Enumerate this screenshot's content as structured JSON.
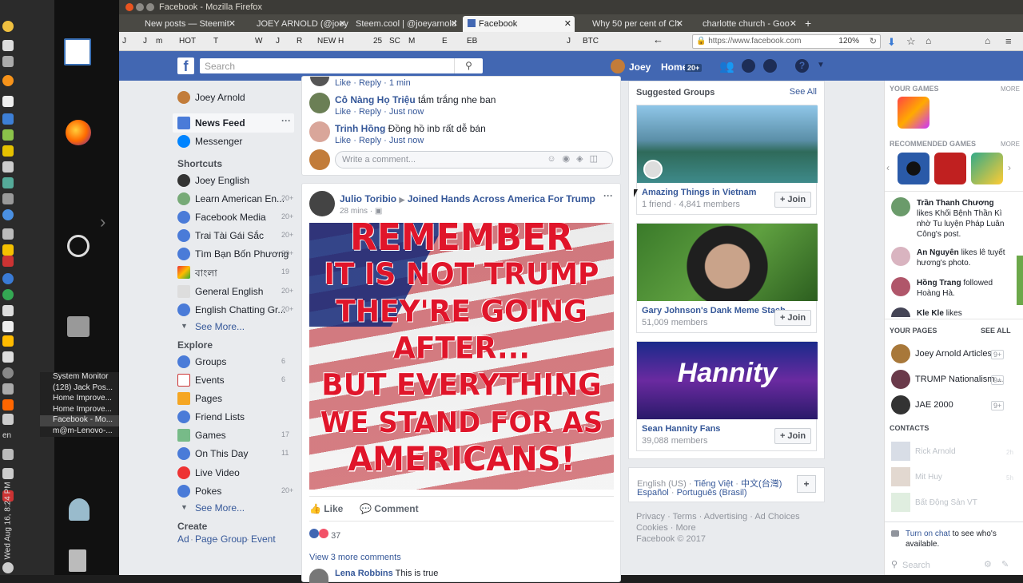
{
  "window": {
    "title": "Facebook - Mozilla Firefox"
  },
  "tabs": [
    {
      "label": "New posts — Steemit"
    },
    {
      "label": "JOEY ARNOLD (@joey"
    },
    {
      "label": "Steem.cool | @joeyarnold"
    },
    {
      "label": "Facebook"
    },
    {
      "label": "Why 50 per cent of Ch"
    },
    {
      "label": "charlotte church - Goo"
    }
  ],
  "bookmarks": [
    "J",
    "J",
    "m",
    "HOT",
    "T",
    "W",
    "J",
    "R",
    "NEW",
    "H",
    "25",
    "SC",
    "M",
    "E",
    "EB",
    "J",
    "BTC"
  ],
  "url": {
    "value": "https://www.facebook.com",
    "zoom": "120%"
  },
  "winlist": [
    "System Monitor",
    "(128) Jack Pos...",
    "Home Improve...",
    "Home Improve...",
    "Facebook - Mo...",
    "m@m-Lenovo-..."
  ],
  "clock": "Wed Aug 16, 8:24 PM",
  "lang": "en",
  "fb": {
    "search_placeholder": "Search",
    "user": "Joey",
    "home": "Home",
    "home_count": "20+"
  },
  "leftnav": {
    "profile": "Joey Arnold",
    "news_feed": "News Feed",
    "messenger": "Messenger",
    "shortcuts_title": "Shortcuts",
    "shortcuts": [
      {
        "label": "Joey English",
        "count": ""
      },
      {
        "label": "Learn American En...",
        "count": "20+"
      },
      {
        "label": "Facebook Media",
        "count": "20+"
      },
      {
        "label": "Trai Tài Gái Sắc",
        "count": "20+"
      },
      {
        "label": "Tìm Bạn Bốn Phương",
        "count": "20+"
      },
      {
        "label": "বাংলা",
        "count": "19"
      },
      {
        "label": "General English",
        "count": "20+"
      },
      {
        "label": "English Chatting Gr...",
        "count": "20+"
      }
    ],
    "see_more": "See More...",
    "explore_title": "Explore",
    "explore": [
      {
        "label": "Groups",
        "count": "6"
      },
      {
        "label": "Events",
        "count": "6"
      },
      {
        "label": "Pages",
        "count": ""
      },
      {
        "label": "Friend Lists",
        "count": ""
      },
      {
        "label": "Games",
        "count": "17"
      },
      {
        "label": "On This Day",
        "count": "11"
      },
      {
        "label": "Live Video",
        "count": ""
      },
      {
        "label": "Pokes",
        "count": "20+"
      }
    ],
    "see_more2": "See More...",
    "create_title": "Create",
    "create": [
      "Ad",
      "Page",
      "Group",
      "Event"
    ]
  },
  "comments": [
    {
      "actions": "Like · Reply · 1 min"
    },
    {
      "name": "Cô Nàng Họ Triệu",
      "text": "tắm trắng nhe ban",
      "actions": "Like · Reply · Just now"
    },
    {
      "name": "Trinh Hồng",
      "text": "Đồng hồ inb rất dễ bán",
      "actions": "Like · Reply · Just now"
    }
  ],
  "comment_placeholder": "Write a comment...",
  "post": {
    "author": "Julio Toribio",
    "group": "Joined Hands Across America For Trump",
    "time": "28 mins",
    "image_text": [
      "REMEMBER",
      "IT IS NOT TRUMP",
      "THEY'RE GOING",
      "AFTER...",
      "BUT EVERYTHING",
      "WE STAND FOR AS",
      "AMERICANS!"
    ],
    "like": "Like",
    "comment": "Comment",
    "reactions": "37",
    "view_more": "View 3 more comments",
    "next_commenter": "Lena Robbins",
    "next_comment": "This is true"
  },
  "suggested": {
    "title": "Suggested Groups",
    "see_all": "See All",
    "groups": [
      {
        "name": "Amazing Things in Vietnam",
        "members": "1 friend · 4,841 members"
      },
      {
        "name": "Gary Johnson's Dank Meme Stash",
        "members": "51,009 members"
      },
      {
        "name": "Sean Hannity Fans",
        "members": "39,088 members"
      }
    ],
    "join": "Join"
  },
  "footer": {
    "lang_current": "English (US)",
    "langs": [
      "Tiếng Việt",
      "中文(台灣)",
      "Español",
      "Português (Brasil)"
    ],
    "links": "Privacy · Terms · Advertising · Ad Choices",
    "links2": "Cookies · More",
    "copy": "Facebook © 2017"
  },
  "ticker": {
    "your_games": "YOUR GAMES",
    "more": "MORE",
    "recommended": "RECOMMENDED GAMES",
    "more2": "MORE",
    "stories": [
      {
        "name": "Trần Thanh Chương",
        "text": "likes Khối Bệnh Thần Kì nhờ Tu luyện Pháp Luân Công's post."
      },
      {
        "name": "An Nguyên",
        "text": "likes lê tuyết hương's photo."
      },
      {
        "name": "Hồng Trang",
        "text": "followed Hoàng Hà."
      },
      {
        "name": "Kle Kle",
        "text": "likes"
      }
    ],
    "your_pages": "YOUR PAGES",
    "see_all": "SEE ALL",
    "pages": [
      {
        "name": "Joey Arnold Articles",
        "badge": "9+"
      },
      {
        "name": "TRUMP Nationalism ...",
        "badge": "9+"
      },
      {
        "name": "JAE 2000",
        "badge": "9+"
      }
    ],
    "contacts": "CONTACTS",
    "contact_list": [
      {
        "name": "Rick Arnold",
        "time": "2h"
      },
      {
        "name": "Mit Huy",
        "time": "5h"
      },
      {
        "name": "Bất Động Sản VT",
        "time": ""
      }
    ],
    "chat_link": "Turn on chat",
    "chat_text": "to see who's available.",
    "search": "Search"
  }
}
